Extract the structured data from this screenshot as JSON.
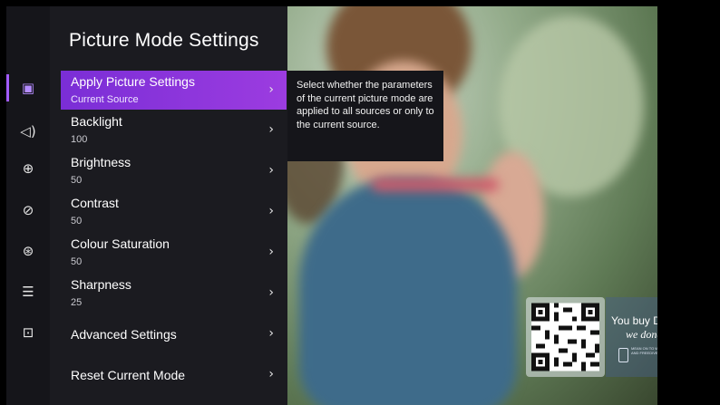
{
  "panel": {
    "title": "Picture Mode Settings",
    "items": [
      {
        "label": "Apply Picture Settings",
        "value": "Current Source",
        "selected": true
      },
      {
        "label": "Backlight",
        "value": "100"
      },
      {
        "label": "Brightness",
        "value": "50"
      },
      {
        "label": "Contrast",
        "value": "50"
      },
      {
        "label": "Colour Saturation",
        "value": "50"
      },
      {
        "label": "Sharpness",
        "value": "25"
      },
      {
        "label": "Advanced Settings"
      },
      {
        "label": "Reset Current Mode"
      }
    ]
  },
  "tooltip": {
    "text": "Select whether the parameters of the current picture mode are applied to all sources or only to the current source."
  },
  "rail": {
    "icons": [
      "picture-icon",
      "sound-icon",
      "network-icon",
      "power-icon",
      "accessibility-icon",
      "system-icon",
      "screen-icon"
    ],
    "active": "picture-icon"
  },
  "overlay": {
    "line1": "You buy Dove,",
    "line2": "we donate",
    "small": "MEAN ON TO WHERE DOVE AND FREEDIVE ... GORKING"
  },
  "colors": {
    "accent": "#9c3ce0",
    "panel_bg": "#1b1b20"
  }
}
